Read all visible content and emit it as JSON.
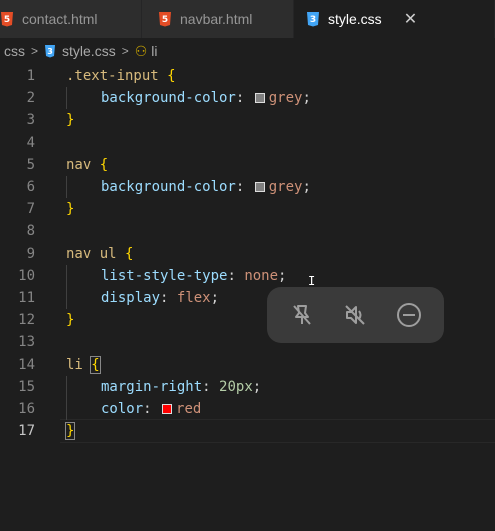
{
  "tabs": [
    {
      "label": "contact.html",
      "icon": "html5-icon",
      "color": "#e44d26"
    },
    {
      "label": "navbar.html",
      "icon": "html5-icon",
      "color": "#e44d26"
    },
    {
      "label": "style.css",
      "icon": "css3-icon",
      "color": "#42a5f5",
      "close": "✕"
    }
  ],
  "breadcrumb": {
    "folder": "css",
    "file": "style.css",
    "symbol": "li",
    "separator": ">"
  },
  "lines": [
    {
      "n": "1"
    },
    {
      "n": "2"
    },
    {
      "n": "3"
    },
    {
      "n": "4"
    },
    {
      "n": "5"
    },
    {
      "n": "6"
    },
    {
      "n": "7"
    },
    {
      "n": "8"
    },
    {
      "n": "9"
    },
    {
      "n": "10"
    },
    {
      "n": "11"
    },
    {
      "n": "12"
    },
    {
      "n": "13"
    },
    {
      "n": "14"
    },
    {
      "n": "15"
    },
    {
      "n": "16"
    },
    {
      "n": "17"
    }
  ],
  "code": {
    "sel1": ".text-input",
    "sel2": "nav",
    "sel3": "nav ul",
    "sel4": "li",
    "open": "{",
    "close": "}",
    "p_bg": "background-color",
    "p_list": "list-style-type",
    "p_display": "display",
    "p_margin": "margin-right",
    "p_color": "color",
    "v_grey": "grey",
    "v_none": "none",
    "v_flex": "flex",
    "v_20": "20px",
    "v_red": "red",
    "colon": ":",
    "semi": ";"
  },
  "overlay": {
    "icons": [
      "pin-off-icon",
      "mute-icon",
      "minus-circle-icon"
    ]
  }
}
